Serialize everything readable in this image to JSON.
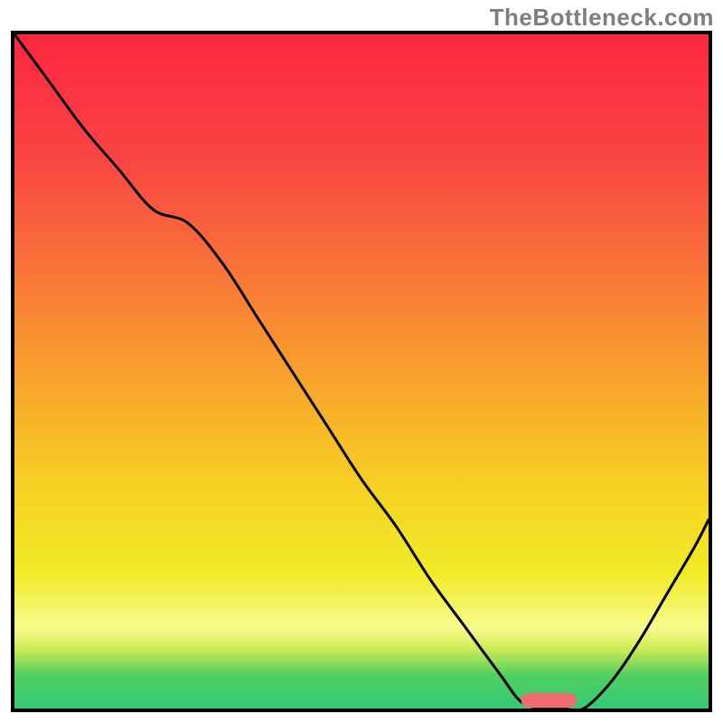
{
  "watermark": "TheBottleneck.com",
  "chart_data": {
    "type": "line",
    "title": "",
    "xlabel": "",
    "ylabel": "",
    "xlim": [
      0,
      100
    ],
    "ylim": [
      0,
      100
    ],
    "background_gradient_stops": [
      {
        "offset": 0.0,
        "color": "#fd2740"
      },
      {
        "offset": 0.18,
        "color": "#f94442"
      },
      {
        "offset": 0.35,
        "color": "#f97438"
      },
      {
        "offset": 0.52,
        "color": "#f8a62c"
      },
      {
        "offset": 0.68,
        "color": "#f6d324"
      },
      {
        "offset": 0.8,
        "color": "#f0eb27"
      },
      {
        "offset": 0.88,
        "color": "#f8fb8e"
      },
      {
        "offset": 0.91,
        "color": "#d3eb57"
      },
      {
        "offset": 0.95,
        "color": "#52d05f"
      },
      {
        "offset": 1.0,
        "color": "#34c877"
      }
    ],
    "series": [
      {
        "name": "bottleneck-curve",
        "x": [
          0,
          5,
          10,
          15,
          20,
          25,
          30,
          35,
          40,
          45,
          50,
          55,
          60,
          65,
          70,
          73,
          76,
          79,
          82,
          86,
          90,
          94,
          98,
          100
        ],
        "y": [
          100,
          93,
          86,
          80,
          74,
          72,
          66,
          58,
          50,
          42,
          34,
          27,
          19,
          12,
          5,
          1,
          0,
          0,
          0,
          4,
          10,
          17,
          24,
          28
        ]
      }
    ],
    "marker": {
      "name": "optimal-range-marker",
      "x_center": 77,
      "y_center": 1.2,
      "width": 8,
      "height": 2.2
    }
  }
}
